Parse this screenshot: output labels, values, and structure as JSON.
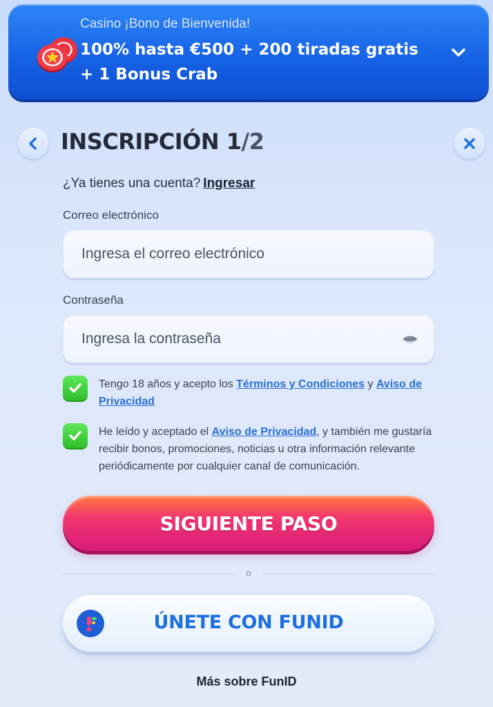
{
  "banner": {
    "kicker": "Casino ¡Bono de Bienvenida!",
    "offer_line1": "100% hasta €500 + 200 tiradas gratis",
    "offer_line2": "+ 1 Bonus Crab",
    "icon": "casino-chips-icon",
    "expand_icon": "chevron-down-icon"
  },
  "header": {
    "title": "INSCRIPCIÓN 1",
    "title_total": "/2",
    "back_icon": "chevron-left-icon",
    "close_icon": "close-icon"
  },
  "login": {
    "prompt": "¿Ya tienes una cuenta?",
    "link": "Ingresar"
  },
  "form": {
    "email": {
      "label": "Correo electrónico",
      "placeholder": "Ingresa el correo electrónico",
      "value": ""
    },
    "password": {
      "label": "Contraseña",
      "placeholder": "Ingresa la contraseña",
      "value": "",
      "toggle_icon": "eye-icon"
    }
  },
  "consents": [
    {
      "checked": true,
      "text_before": "Tengo 18 años y acepto los ",
      "link1": "Términos y Condiciones",
      "text_middle": " y ",
      "link2": "Aviso de Privacidad"
    },
    {
      "checked": true,
      "text_before": "He leído y aceptado el ",
      "link1": "Aviso de Privacidad",
      "text_after": ", y también me gustaría recibir bonos, promociones, noticias u otra información relevante periódicamente por cualquier canal de comunicación."
    }
  ],
  "actions": {
    "next_label": "SIGUIENTE PASO",
    "divider_label": "o",
    "funid_label": "ÚNETE CON FUNID",
    "funid_icon": "funid-logo-icon",
    "more_funid": "Más sobre FunID"
  },
  "colors": {
    "banner_blue": "#1763e6",
    "primary_gradient_top": "#ff7a3c",
    "primary_gradient_bottom": "#d91a7a",
    "checkbox_green": "#2fbe2a",
    "link_blue": "#2a6fd6",
    "funid_blue": "#1f6fe0"
  }
}
